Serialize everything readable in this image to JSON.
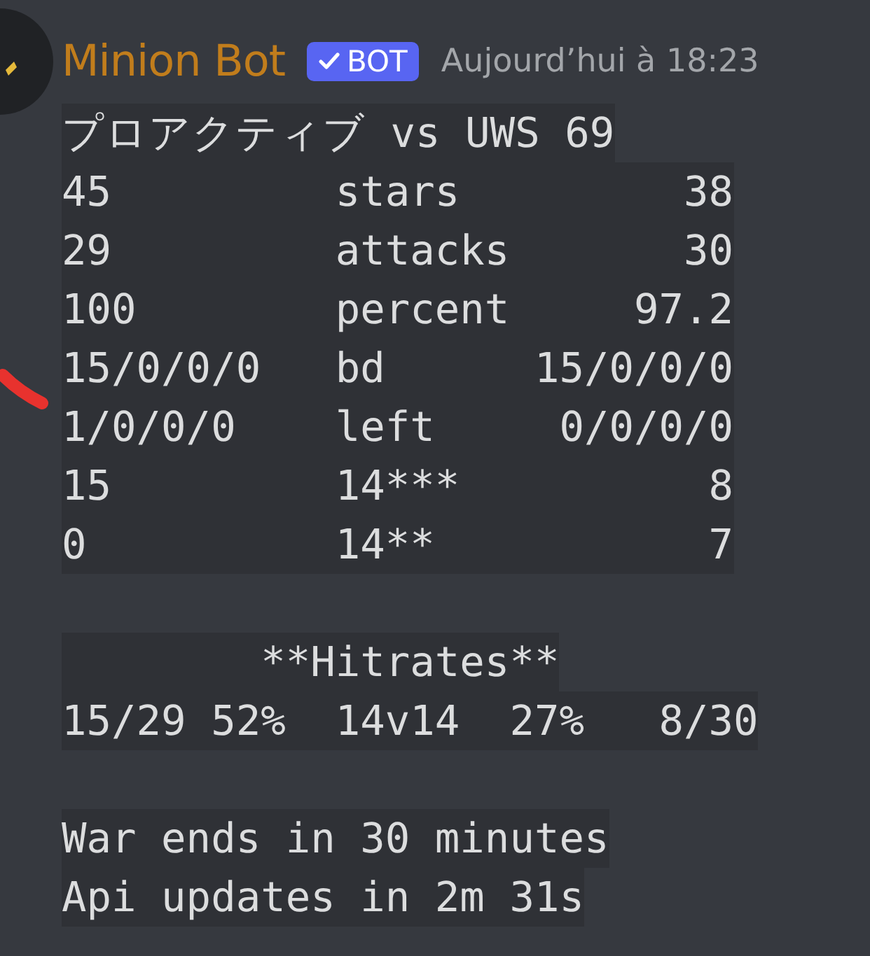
{
  "message": {
    "author": "Minion Bot",
    "badge": "BOT",
    "timestamp": "Aujourd’hui à 18:23",
    "blocks": [
      [
        "プロアクティブ vs UWS 69",
        "45         stars         38",
        "29         attacks       30",
        "100        percent     97.2",
        "15/0/0/0   bd      15/0/0/0",
        "1/0/0/0    left     0/0/0/0",
        "15         14***          8",
        "0          14**           7"
      ],
      [
        "        **Hitrates**",
        "15/29 52%  14v14  27%   8/30"
      ],
      [
        "War ends in 30 minutes",
        "Api updates in 2m 31s"
      ]
    ]
  }
}
